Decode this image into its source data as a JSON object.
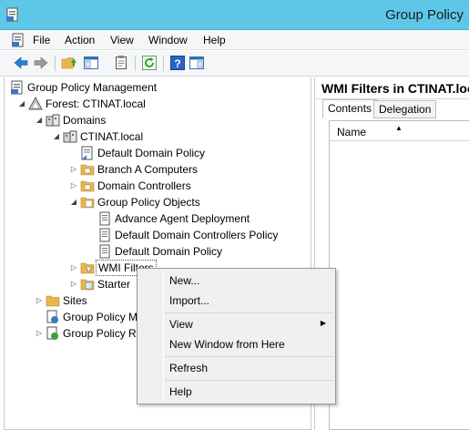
{
  "window": {
    "title": "Group Policy"
  },
  "menubar": {
    "items": [
      "File",
      "Action",
      "View",
      "Window",
      "Help"
    ]
  },
  "toolbar": {
    "buttons": [
      "back-arrow-icon",
      "forward-arrow-icon",
      "up-folder-icon",
      "show-hide-console-tree-icon",
      "properties-icon",
      "refresh-icon",
      "help-icon",
      "show-hide-action-pane-icon"
    ]
  },
  "tree": {
    "nodes": [
      {
        "label": "Group Policy Management"
      },
      {
        "label": "Forest: CTINAT.local"
      },
      {
        "label": "Domains"
      },
      {
        "label": "CTINAT.local"
      },
      {
        "label": "Default Domain Policy"
      },
      {
        "label": "Branch A Computers"
      },
      {
        "label": "Domain Controllers"
      },
      {
        "label": "Group Policy Objects"
      },
      {
        "label": "Advance Agent Deployment"
      },
      {
        "label": "Default Domain Controllers Policy"
      },
      {
        "label": "Default Domain Policy"
      },
      {
        "label": "WMI Filters"
      },
      {
        "label": "Starter"
      },
      {
        "label": "Sites"
      },
      {
        "label": "Group Policy M"
      },
      {
        "label": "Group Policy R"
      }
    ]
  },
  "right_pane": {
    "header": "WMI Filters in CTINAT.loc",
    "tabs": [
      "Contents",
      "Delegation"
    ],
    "active_tab": "Contents",
    "column": "Name"
  },
  "context_menu": {
    "items": [
      "New...",
      "Import...",
      "View",
      "New Window from Here",
      "Refresh",
      "Help"
    ]
  },
  "colors": {
    "titlebar": "#5ec7e8",
    "folder": "#e8b64a",
    "selection": "#cce8ff"
  }
}
